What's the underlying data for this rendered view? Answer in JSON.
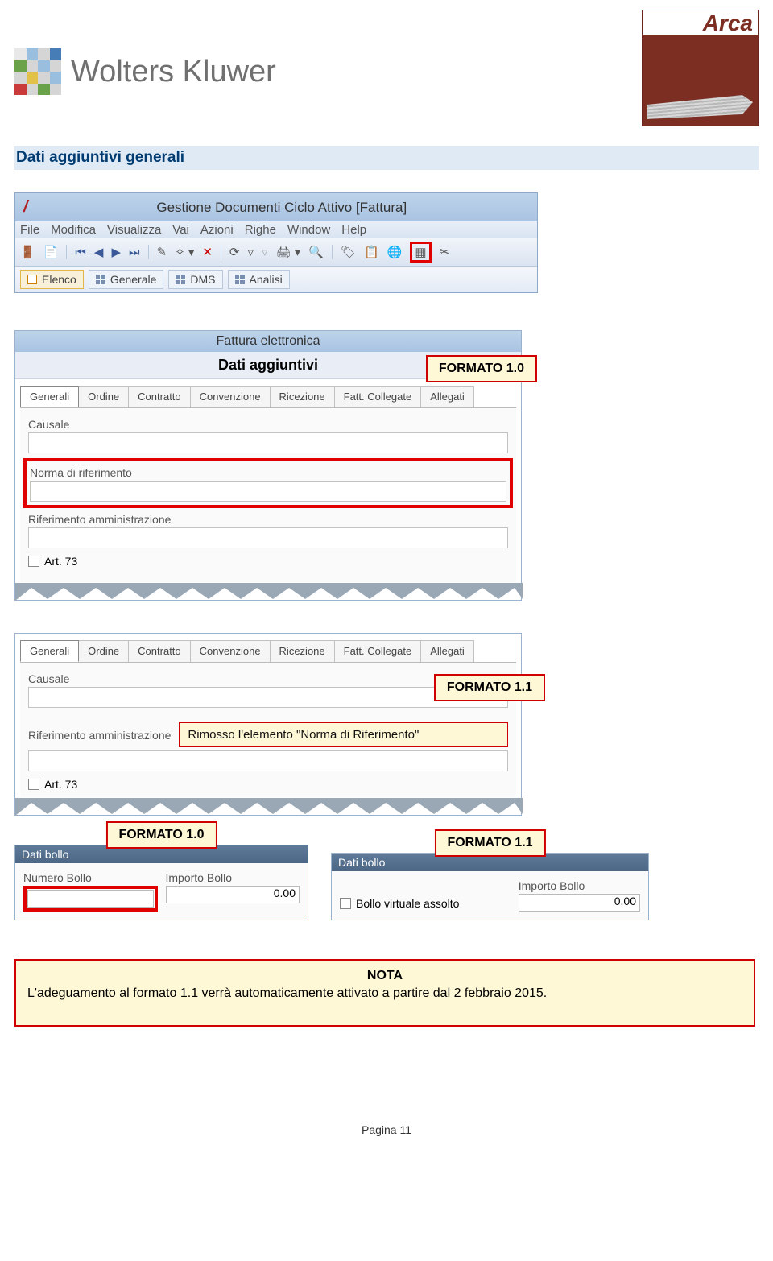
{
  "header": {
    "wk_name": "Wolters Kluwer",
    "arca_name": "Arca"
  },
  "section_title": "Dati aggiuntivi generali",
  "win1": {
    "title": "Gestione Documenti Ciclo Attivo [Fattura]",
    "menu": [
      "File",
      "Modifica",
      "Visualizza",
      "Vai",
      "Azioni",
      "Righe",
      "Window",
      "Help"
    ],
    "tabs": [
      "Elenco",
      "Generale",
      "DMS",
      "Analisi"
    ]
  },
  "panel2": {
    "title": "Fattura elettronica",
    "subtitle": "Dati aggiuntivi",
    "tabs": [
      "Generali",
      "Ordine",
      "Contratto",
      "Convenzione",
      "Ricezione",
      "Fatt. Collegate",
      "Allegati"
    ],
    "label_causale": "Causale",
    "label_norma": "Norma di riferimento",
    "label_rifamm": "Riferimento amministrazione",
    "label_art73": "Art. 73"
  },
  "panel3": {
    "tabs": [
      "Generali",
      "Ordine",
      "Contratto",
      "Convenzione",
      "Ricezione",
      "Fatt. Collegate",
      "Allegati"
    ],
    "label_causale": "Causale",
    "label_rifamm": "Riferimento amministrazione",
    "label_art73": "Art. 73",
    "note_text": "Rimosso l'elemento \"Norma di Riferimento\""
  },
  "callouts": {
    "f10": "FORMATO 1.0",
    "f11": "FORMATO 1.1"
  },
  "bollo_left": {
    "title": "Dati bollo",
    "label_numero": "Numero Bollo",
    "label_importo": "Importo Bollo",
    "importo_value": "0.00"
  },
  "bollo_right": {
    "title": "Dati bollo",
    "label_ck": "Bollo virtuale assolto",
    "label_importo": "Importo Bollo",
    "importo_value": "0.00"
  },
  "nota": {
    "title": "NOTA",
    "body": "L'adeguamento al formato 1.1 verrà automaticamente attivato a partire dal 2 febbraio 2015."
  },
  "page_number": "Pagina 11"
}
